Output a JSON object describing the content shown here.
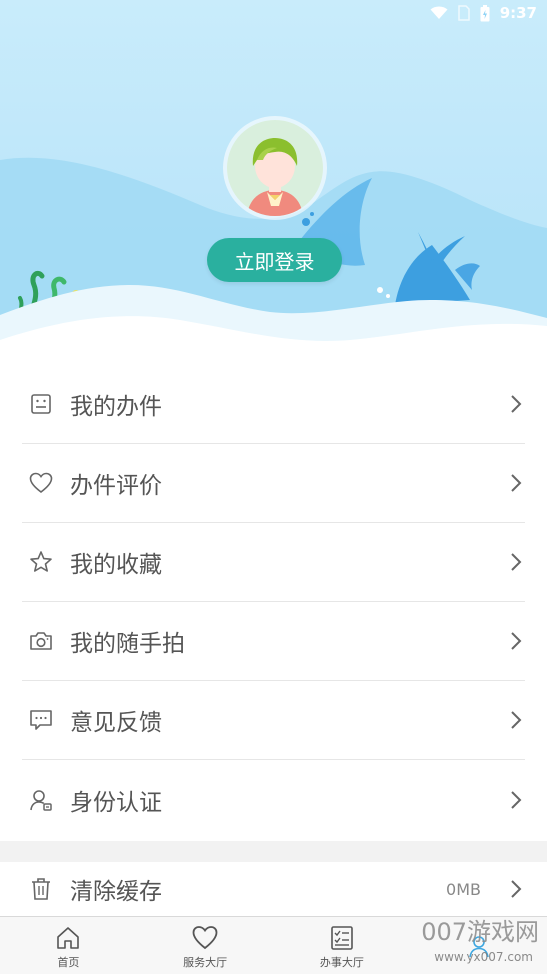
{
  "status_bar": {
    "time": "9:37"
  },
  "login": {
    "button_label": "立即登录"
  },
  "menu": {
    "items": [
      {
        "label": "我的办件",
        "icon": "document-icon"
      },
      {
        "label": "办件评价",
        "icon": "heart-icon"
      },
      {
        "label": "我的收藏",
        "icon": "star-icon"
      },
      {
        "label": "我的随手拍",
        "icon": "camera-icon"
      },
      {
        "label": "意见反馈",
        "icon": "message-icon"
      },
      {
        "label": "身份认证",
        "icon": "user-id-icon"
      }
    ]
  },
  "cache": {
    "label": "清除缓存",
    "size": "0MB",
    "icon": "trash-icon"
  },
  "tabs": [
    {
      "label": "首页",
      "icon": "home-icon"
    },
    {
      "label": "服务大厅",
      "icon": "heart-icon"
    },
    {
      "label": "办事大厅",
      "icon": "checklist-icon"
    },
    {
      "label": "",
      "icon": "user-icon"
    }
  ],
  "watermark": {
    "main": "007游戏网",
    "sub": "www.yx007.com"
  },
  "colors": {
    "accent": "#2ab09f",
    "header_sky": "#c9ecfb",
    "text": "#555555",
    "divider": "#e6e6e6"
  }
}
